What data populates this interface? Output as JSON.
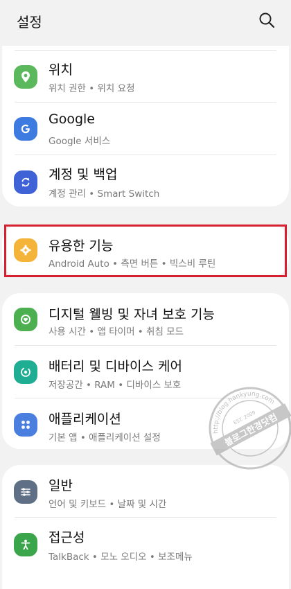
{
  "header": {
    "title": "설정",
    "search_icon": "search-icon"
  },
  "items": [
    {
      "title": "위치",
      "subtitle": "위치 권한 • 위치 요청",
      "icon": "location-icon",
      "color": "#5cb85c"
    },
    {
      "title": "Google",
      "subtitle": "Google 서비스",
      "icon": "google-icon",
      "color": "#3d7be0"
    },
    {
      "title": "계정 및 백업",
      "subtitle": "계정 관리 • Smart Switch",
      "icon": "sync-icon",
      "color": "#3f63d6"
    },
    {
      "title": "유용한 기능",
      "subtitle": "Android Auto • 측면 버튼 • 빅스비 루틴",
      "icon": "gear-plus-icon",
      "color": "#f4b43a"
    },
    {
      "title": "디지털 웰빙 및 자녀 보호 기능",
      "subtitle": "사용 시간 • 앱 타이머 • 취침 모드",
      "icon": "wellbeing-icon",
      "color": "#4caf50"
    },
    {
      "title": "배터리 및 디바이스 케어",
      "subtitle": "저장공간 • RAM • 디바이스 보호",
      "icon": "device-care-icon",
      "color": "#1fae93"
    },
    {
      "title": "애플리케이션",
      "subtitle": "기본 앱 • 애플리케이션 설정",
      "icon": "apps-icon",
      "color": "#4a7fe0"
    },
    {
      "title": "일반",
      "subtitle": "언어 및 키보드 • 날짜 및 시간",
      "icon": "sliders-icon",
      "color": "#5e6f86"
    },
    {
      "title": "접근성",
      "subtitle": "TalkBack • 모노 오디오 • 보조메뉴",
      "icon": "accessibility-icon",
      "color": "#3aa54a"
    }
  ],
  "watermark": {
    "main": "블로그한경닷컴",
    "ring_top": "http://blog.hankyung.com",
    "est": "EST. 2009"
  },
  "colors": {
    "highlight": "#d4202f",
    "background": "#f2f2f2",
    "card": "#ffffff"
  }
}
